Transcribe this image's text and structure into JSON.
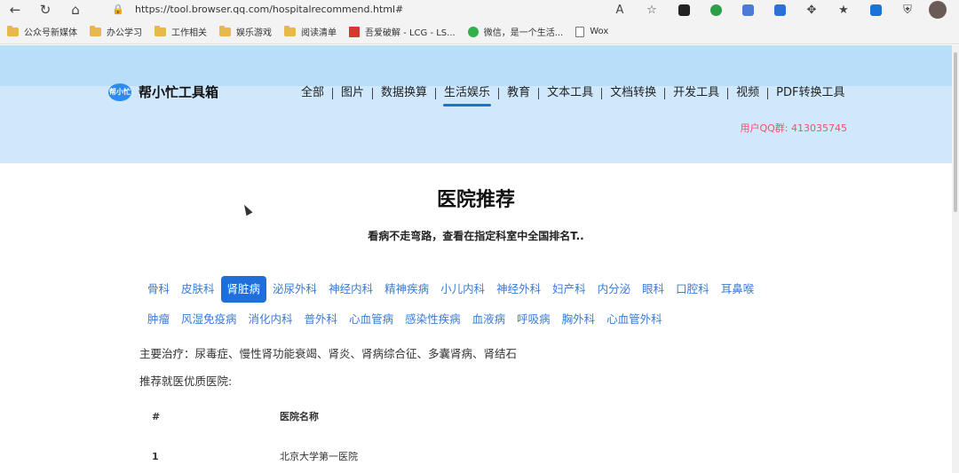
{
  "browser": {
    "url": "https://tool.browser.qq.com/hospitalrecommend.html#",
    "bookmarks": [
      {
        "label": "公众号新媒体",
        "icon": "folder-icon"
      },
      {
        "label": "办公学习",
        "icon": "folder-icon"
      },
      {
        "label": "工作相关",
        "icon": "folder-icon"
      },
      {
        "label": "娱乐游戏",
        "icon": "folder-icon"
      },
      {
        "label": "阅读清单",
        "icon": "folder-icon"
      },
      {
        "label": "吾爱破解 - LCG - LS...",
        "icon": "site-icon"
      },
      {
        "label": "微信，是一个生活...",
        "icon": "wechat-icon"
      },
      {
        "label": "Wox",
        "icon": "page-icon"
      }
    ]
  },
  "site": {
    "logo_mark": "帮小忙",
    "logo_text": "帮小忙工具箱",
    "menu": [
      "全部",
      "图片",
      "数据换算",
      "生活娱乐",
      "教育",
      "文本工具",
      "文档转换",
      "开发工具",
      "视频",
      "PDF转换工具"
    ],
    "active_menu": "生活娱乐",
    "qq_group": "用户QQ群: 413035745"
  },
  "main": {
    "title": "医院推荐",
    "subtitle": "看病不走弯路，查看在指定科室中全国排名T..",
    "departments_row1": [
      "骨科",
      "皮肤科",
      "肾脏病",
      "泌尿外科",
      "神经内科",
      "精神疾病",
      "小儿内科",
      "神经外科",
      "妇产科",
      "内分泌",
      "眼科",
      "口腔科",
      "耳鼻喉"
    ],
    "departments_row2": [
      "肿瘤",
      "风湿免疫病",
      "消化内科",
      "普外科",
      "心血管病",
      "感染性疾病",
      "血液病",
      "呼吸病",
      "胸外科",
      "心血管外科"
    ],
    "active_department": "肾脏病",
    "treatment_text": "主要治疗：尿毒症、慢性肾功能衰竭、肾炎、肾病综合征、多囊肾病、肾结石",
    "recommend_label": "推荐就医优质医院:",
    "table_headers": [
      "#",
      "医院名称"
    ],
    "rows": [
      {
        "num": "1",
        "name": "北京大学第一医院"
      }
    ]
  },
  "colors": {
    "accent": "#1e6fd9",
    "link": "#3a7bd5",
    "qq": "#f2506a",
    "hero_top": "#b9defa",
    "hero_bottom": "#cfe8fc"
  }
}
